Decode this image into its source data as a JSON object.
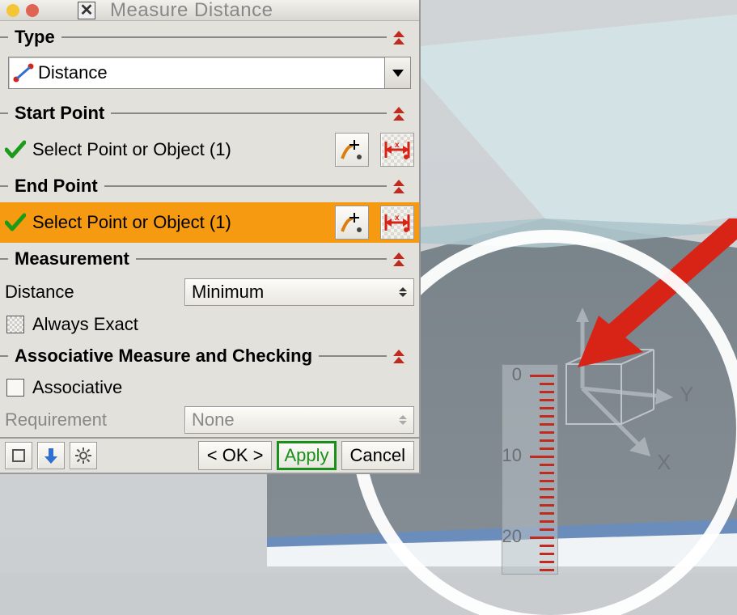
{
  "window": {
    "title": "Measure Distance"
  },
  "sections": {
    "type": {
      "label": "Type",
      "dropdown": {
        "value": "Distance"
      }
    },
    "start_point": {
      "label": "Start Point",
      "prompt": "Select Point or Object (1)"
    },
    "end_point": {
      "label": "End Point",
      "prompt": "Select Point or Object (1)"
    },
    "measurement": {
      "label": "Measurement",
      "distance_label": "Distance",
      "distance_value": "Minimum",
      "always_exact_label": "Always Exact"
    },
    "assoc": {
      "label": "Associative Measure and Checking",
      "associative_label": "Associative",
      "requirement_label": "Requirement",
      "requirement_value": "None"
    }
  },
  "footer": {
    "ok": "< OK >",
    "apply": "Apply",
    "cancel": "Cancel"
  },
  "viewport": {
    "axes": {
      "x": "X",
      "y": "Y"
    },
    "ruler": {
      "min": 0,
      "max": 20,
      "ticks": [
        0,
        10,
        20
      ]
    }
  },
  "icons": {
    "distance": "distance-icon",
    "snap_point": "snap-point-icon",
    "measure_x": "measure-x-icon",
    "arrow_down_blue": "arrow-down-blue-icon",
    "gear": "gear-icon",
    "collapse": "chevron-up-icon"
  }
}
